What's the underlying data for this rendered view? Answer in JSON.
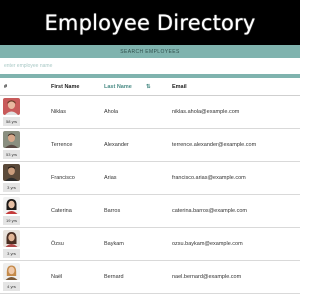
{
  "header": {
    "title": "Employee Directory"
  },
  "search": {
    "label": "SEARCH EMPLOYEES",
    "placeholder": "enter employee name",
    "value": ""
  },
  "table": {
    "columns": {
      "index": "#",
      "first": "First Name",
      "last": "Last Name",
      "sort_icon": "⇅",
      "email": "Email"
    },
    "rows": [
      {
        "first": "Niklas",
        "last": "Ahola",
        "email": "niklas.ahola@example.com",
        "age": "58 yrs"
      },
      {
        "first": "Terrence",
        "last": "Alexander",
        "email": "terrence.alexander@example.com",
        "age": "53 yrs"
      },
      {
        "first": "Francisco",
        "last": "Arias",
        "email": "francisco.arias@example.com",
        "age": "3 yrs"
      },
      {
        "first": "Caterina",
        "last": "Barros",
        "email": "caterina.barros@example.com",
        "age": "19 yrs"
      },
      {
        "first": "Özsu",
        "last": "Baykam",
        "email": "ozsu.baykam@example.com",
        "age": "3 yrs"
      },
      {
        "first": "Naël",
        "last": "Bernard",
        "email": "nael.bernard@example.com",
        "age": "4 yrs"
      }
    ]
  },
  "colors": {
    "header_bg": "#000000",
    "accent": "#7fb3ae",
    "sort_active": "#4b8c86"
  }
}
